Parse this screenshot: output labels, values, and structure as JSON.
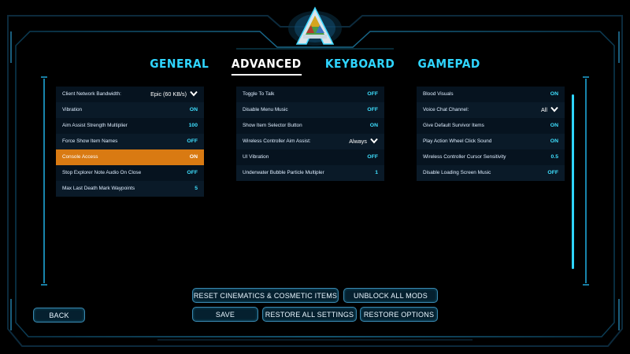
{
  "tabs": [
    {
      "label": "GENERAL",
      "active": false
    },
    {
      "label": "ADVANCED",
      "active": true
    },
    {
      "label": "KEYBOARD",
      "active": false
    },
    {
      "label": "GAMEPAD",
      "active": false
    }
  ],
  "columns": {
    "left": [
      {
        "label": "Client Network Bandwidth:",
        "value": "Epic (60 KB/s)",
        "type": "dropdown"
      },
      {
        "label": "Vibration",
        "value": "ON",
        "type": "toggle"
      },
      {
        "label": "Aim Assist Strength Multiplier",
        "value": "100",
        "type": "number"
      },
      {
        "label": "Force Show Item Names",
        "value": "OFF",
        "type": "toggle"
      },
      {
        "label": "Console Access",
        "value": "ON",
        "type": "toggle",
        "highlighted": true
      },
      {
        "label": "Stop Explorer Note Audio On Close",
        "value": "OFF",
        "type": "toggle"
      },
      {
        "label": "Max Last Death Mark Waypoints",
        "value": "5",
        "type": "number"
      }
    ],
    "middle": [
      {
        "label": "Toggle To Talk",
        "value": "OFF",
        "type": "toggle"
      },
      {
        "label": "Disable Menu Music",
        "value": "OFF",
        "type": "toggle"
      },
      {
        "label": "Show Item Selector Button",
        "value": "ON",
        "type": "toggle"
      },
      {
        "label": "Wireless Controller Aim Assist:",
        "value": "Always",
        "type": "dropdown"
      },
      {
        "label": "UI Vibration",
        "value": "OFF",
        "type": "toggle"
      },
      {
        "label": "Underwater Bubble Particle Multipler",
        "value": "1",
        "type": "number"
      }
    ],
    "right": [
      {
        "label": "Blood Visuals",
        "value": "ON",
        "type": "toggle"
      },
      {
        "label": "Voice Chat Channel:",
        "value": "All",
        "type": "dropdown"
      },
      {
        "label": "Give Default Survivor Items",
        "value": "ON",
        "type": "toggle"
      },
      {
        "label": "Play Action Wheel Click Sound",
        "value": "ON",
        "type": "toggle"
      },
      {
        "label": "Wireless Controller Cursor Sensitivity",
        "value": "0.5",
        "type": "number"
      },
      {
        "label": "Disable Loading Screen Music",
        "value": "OFF",
        "type": "toggle"
      }
    ]
  },
  "buttons": {
    "back": "BACK",
    "reset_cinematics": "RESET CINEMATICS & COSMETIC ITEMS",
    "unblock_mods": "UNBLOCK ALL MODS",
    "save": "SAVE",
    "restore_all": "RESTORE ALL SETTINGS",
    "restore_options": "RESTORE OPTIONS"
  },
  "colors": {
    "accent": "#2fd5ff",
    "highlight": "#d97a12",
    "row_bg": "#06131f",
    "frame": "#1f9fd0"
  }
}
